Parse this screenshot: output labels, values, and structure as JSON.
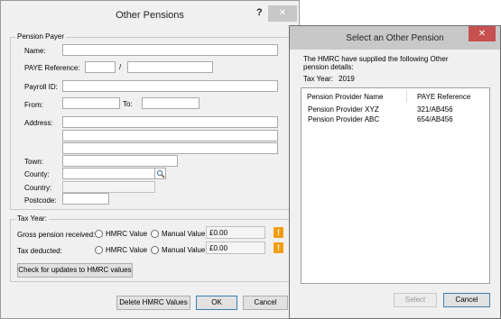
{
  "pension_dialog": {
    "title": "Other Pensions",
    "help_label": "?",
    "close_label": "✕",
    "payer_group": "Pension Payer",
    "labels": {
      "name": "Name:",
      "paye_reference": "PAYE Reference:",
      "paye_sep": "/",
      "payroll_id": "Payroll ID:",
      "from": "From:",
      "to": "To:",
      "address": "Address:",
      "town": "Town:",
      "county": "County:",
      "country": "Country:",
      "postcode": "Postcode:"
    },
    "tax_year_group": "Tax Year:",
    "rows": [
      {
        "label": "Gross pension received:",
        "hmrc_option": "HMRC Value",
        "manual_option": "Manual Value",
        "value": "£0.00",
        "warning": "!"
      },
      {
        "label": "Tax deducted:",
        "hmrc_option": "HMRC Value",
        "manual_option": "Manual Value",
        "value": "£0.00",
        "warning": "!"
      }
    ],
    "check_updates_button": "Check for updates to HMRC values",
    "delete_button": "Delete HMRC Values",
    "ok_button": "OK",
    "cancel_button": "Cancel"
  },
  "select_dialog": {
    "title": "Select an Other Pension",
    "close_label": "✕",
    "message": "The HMRC have supplied the following Other pension details:",
    "tax_year_label": "Tax Year:",
    "tax_year": "2019",
    "columns": [
      "Pension Provider Name",
      "PAYE Reference"
    ],
    "rows": [
      {
        "name": "Pension Provider XYZ",
        "paye": "321/AB456"
      },
      {
        "name": "Pension Provider ABC",
        "paye": "654/AB456"
      }
    ],
    "select_button": "Select",
    "cancel_button": "Cancel"
  },
  "colors": {
    "dialog_bg": "#f0f0f0",
    "warning": "#f39c12",
    "close_active": "#c75050"
  }
}
